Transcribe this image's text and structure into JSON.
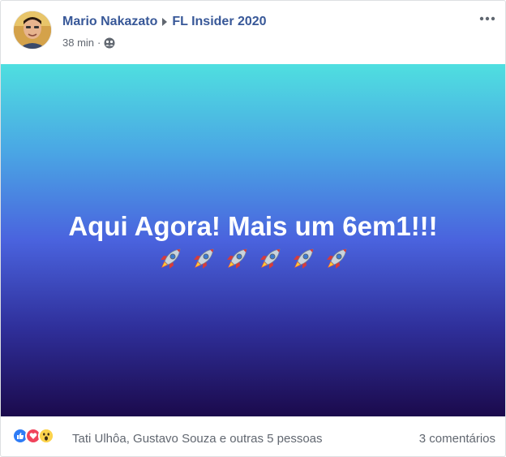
{
  "post": {
    "author": "Mario Nakazato",
    "group": "FL Insider 2020",
    "time": "38 min",
    "separator": "·",
    "privacy_icon": "group-icon",
    "banner_text": "Aqui Agora! Mais um 6em1!!!",
    "rocket_count": 6
  },
  "footer": {
    "reactions": [
      "like-icon",
      "love-icon",
      "wow-icon"
    ],
    "reacted_by": "Tati Ulhôa, Gustavo Souza e outras 5 pessoas",
    "comments": "3 comentários"
  },
  "colors": {
    "author_link": "#385898",
    "meta_text": "#616770",
    "like": "#2e7cf6",
    "love": "#f0435b",
    "wow": "#fcd34c"
  }
}
